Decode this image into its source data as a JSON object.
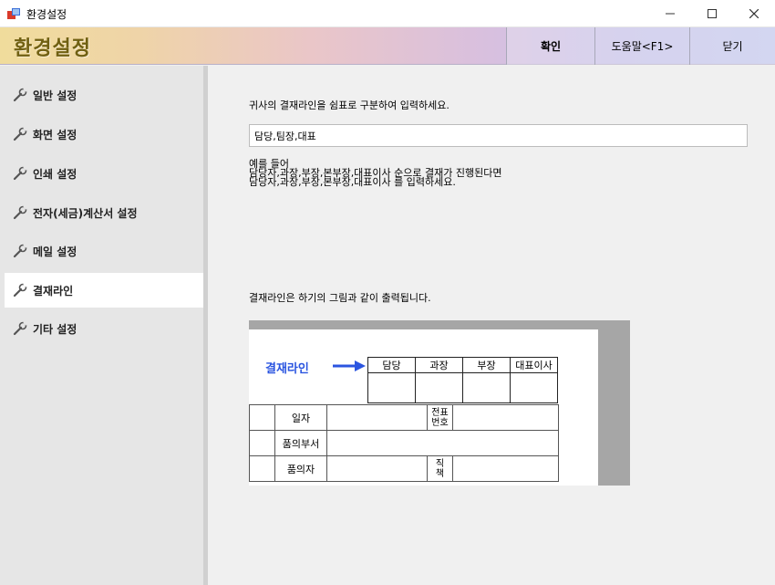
{
  "window": {
    "title": "환경설정"
  },
  "header": {
    "title": "환경설정",
    "confirm_label": "확인",
    "help_label": "도움말<F1>",
    "close_label": "닫기"
  },
  "sidebar": {
    "items": [
      {
        "label": "일반 설정"
      },
      {
        "label": "화면 설정"
      },
      {
        "label": "인쇄 설정"
      },
      {
        "label": "전자(세금)계산서 설정"
      },
      {
        "label": "메일 설정"
      },
      {
        "label": "결재라인"
      },
      {
        "label": "기타 설정"
      }
    ],
    "selected": "결재라인"
  },
  "content": {
    "prompt": "귀사의 결재라인을 쉼표로 구분하여 입력하세요.",
    "input_value": "담당,팀장,대표",
    "example_lines": [
      "예를 들어",
      "담당자,과장,부장,본부장,대표이사 순으로 결재가 진행된다면",
      "담당자,과장,부장,본부장,대표이사 를 입력하세요."
    ],
    "note": "결재라인은 하기의 그림과 같이 출력됩니다."
  },
  "preview": {
    "label": "결재라인",
    "approvers": [
      "담당",
      "과장",
      "부장",
      "대표이사"
    ],
    "doc_rows": {
      "date": "일자",
      "voucher_no": "전표\n번호",
      "dept": "품의부서",
      "requester": "품의자",
      "position": "직\n책"
    }
  },
  "colors": {
    "header_title": "#706012",
    "preview_label": "#2b55e0",
    "sidebar_bg": "#e6e6e6",
    "active_item_bg": "#ffffff"
  }
}
